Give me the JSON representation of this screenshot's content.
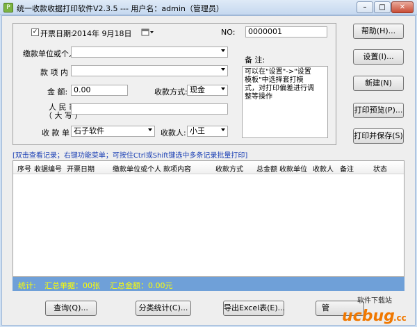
{
  "window": {
    "title": "统一收款收据打印软件V2.3.5 --- 用户名：admin（管理员）",
    "icon_glyph": "P",
    "buttons": {
      "minimize": "–",
      "maximize": "□",
      "close": "✕"
    }
  },
  "form": {
    "invoice_date_label": "开票日期:",
    "invoice_date_checked": "✓",
    "invoice_date_value": "2014年  9月18日",
    "no_label": "NO:",
    "no_value": "0000001",
    "payer_label": "缴款单位或个人:",
    "payer_value": "",
    "item_label": "款 项 内 容:",
    "item_value": "",
    "amount_label": "金        额:",
    "amount_value": "0.00",
    "pay_method_label": "收款方式:",
    "pay_method_value": "现金",
    "rmb_label_line1": "人    民    币",
    "rmb_label_line2": "（ 大  写 ）",
    "rmb_value": "",
    "collector_unit_label": "收 款 单 位:",
    "collector_unit_value": "石子软件",
    "payee_label": "收款人:",
    "payee_value": "小王",
    "memo_label": "备 注:",
    "memo_text": "可以在\"设置\"->\"设置模板\"中选择套打模式，对打印偏差进行调整等操作"
  },
  "side_buttons": {
    "help": "帮助(H)...",
    "settings": "设置(I)...",
    "new": "新建(N)",
    "print_preview": "打印预览(P)...",
    "print_save": "打印并保存(S)"
  },
  "hint": "[双击查看记录；右键功能菜单；可按住Ctrl或Shift键选中多条记录批量打印]",
  "grid": {
    "columns": [
      "序号",
      "收据编号",
      "开票日期",
      "缴款单位或个人",
      "款项内容",
      "收款方式",
      "总金额",
      "收款单位",
      "收款人",
      "备注",
      "状态"
    ]
  },
  "status": {
    "label": "统计:",
    "count_text": "汇总单据：00张",
    "sum_text": "汇总金额：0.00元"
  },
  "bottom_buttons": {
    "query": "查询(Q)...",
    "category_stats": "分类统计(C)...",
    "export_excel": "导出Excel表(E)...",
    "manage": "管"
  },
  "watermark": {
    "brand": "ucbug",
    "suffix": ".cc",
    "cn": "软件下载站"
  },
  "colors": {
    "hint": "#1a3fb4",
    "status_bar": "#6fa0d8",
    "status_text": "#ffff00",
    "watermark_orange": "#f07800"
  }
}
